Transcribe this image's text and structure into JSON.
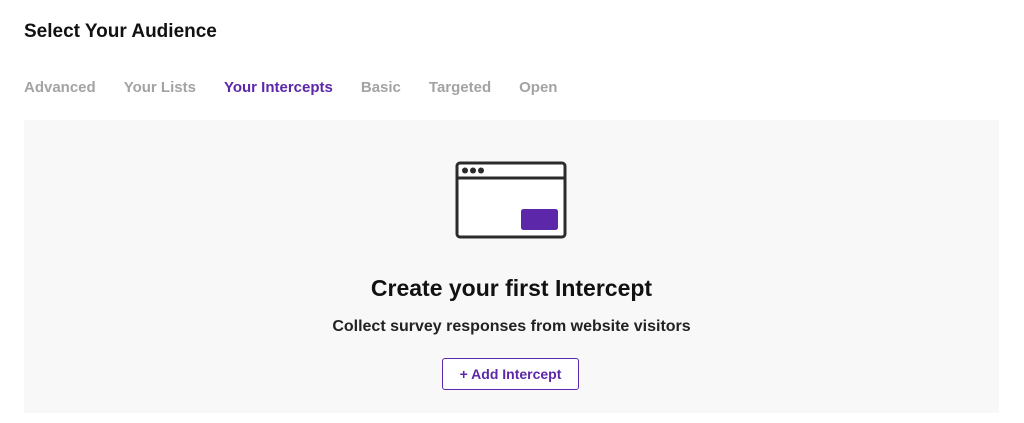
{
  "header": {
    "title": "Select Your Audience"
  },
  "tabs": [
    {
      "label": "Advanced",
      "active": false
    },
    {
      "label": "Your Lists",
      "active": false
    },
    {
      "label": "Your Intercepts",
      "active": true
    },
    {
      "label": "Basic",
      "active": false
    },
    {
      "label": "Targeted",
      "active": false
    },
    {
      "label": "Open",
      "active": false
    }
  ],
  "empty_state": {
    "icon": "browser-window-icon",
    "title": "Create your first Intercept",
    "subtitle": "Collect survey responses from website visitors",
    "button_label": "+ Add Intercept"
  },
  "colors": {
    "accent": "#5c27a8",
    "inactive_tab": "#a3a3a3",
    "panel_background": "#f8f8f8"
  }
}
